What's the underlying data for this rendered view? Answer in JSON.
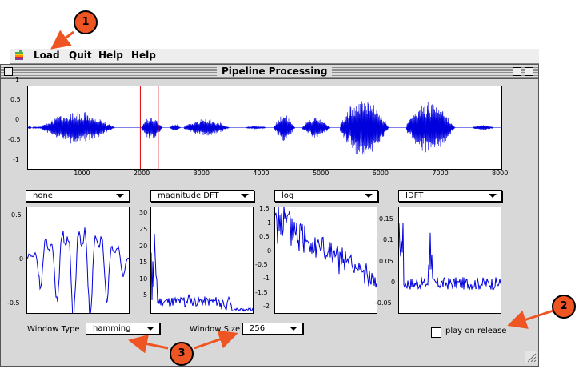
{
  "menubar": {
    "items": [
      "Load",
      "Quit",
      "Help",
      "Help"
    ]
  },
  "window": {
    "title": "Pipeline Processing"
  },
  "waveform": {
    "y_ticks": [
      "1",
      "0.5",
      "0",
      "-0.5",
      "-1"
    ],
    "x_ticks": [
      "1000",
      "2000",
      "3000",
      "4000",
      "5000",
      "6000",
      "7000",
      "8000"
    ],
    "selection_range": [
      1980,
      2280
    ]
  },
  "stages": [
    {
      "dropdown": "none",
      "y_ticks": [
        "0.5",
        "0",
        "-0.5"
      ]
    },
    {
      "dropdown": "magnitude DFT",
      "y_ticks": [
        "30",
        "25",
        "20",
        "15",
        "10",
        "5"
      ]
    },
    {
      "dropdown": "log",
      "y_ticks": [
        "1.5",
        "1",
        "0.5",
        "0",
        "-0.5",
        "-1",
        "-1.5",
        "-2"
      ]
    },
    {
      "dropdown": "IDFT",
      "y_ticks": [
        "0.15",
        "0.1",
        "0.05",
        "0",
        "-0.05"
      ]
    }
  ],
  "controls": {
    "window_type_label": "Window Type",
    "window_type_value": "hamming",
    "window_size_label": "Window Size",
    "window_size_value": "256",
    "play_on_release_label": "play on release"
  },
  "callouts": [
    "1",
    "2",
    "3"
  ],
  "colors": {
    "signal": "#0000dd",
    "selection": "#dd0000",
    "callout": "#ee5522"
  }
}
